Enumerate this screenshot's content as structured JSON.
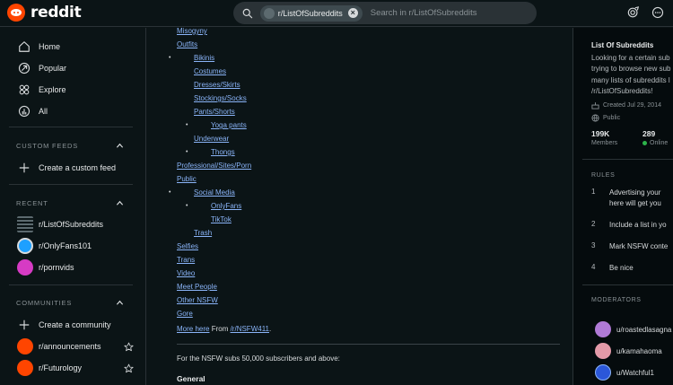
{
  "header": {
    "logo_text": "reddit",
    "search_chip": "r/ListOfSubreddits",
    "search_placeholder": "Search in r/ListOfSubreddits"
  },
  "sidebar": {
    "nav": [
      {
        "label": "Home",
        "icon": "home-icon"
      },
      {
        "label": "Popular",
        "icon": "popular-icon"
      },
      {
        "label": "Explore",
        "icon": "explore-icon"
      },
      {
        "label": "All",
        "icon": "all-icon"
      }
    ],
    "custom_feeds_title": "CUSTOM FEEDS",
    "create_custom_feed": "Create a custom feed",
    "recent_title": "RECENT",
    "recent": [
      "r/ListOfSubreddits",
      "r/OnlyFans101",
      "r/pornvids"
    ],
    "communities_title": "COMMUNITIES",
    "create_community": "Create a community",
    "communities": [
      "r/announcements",
      "r/Futurology"
    ]
  },
  "post": {
    "items": {
      "misogyny": "Misogyny",
      "outfits": "Outfits",
      "bikinis": "Bikinis",
      "costumes": "Costumes",
      "dresses": "Dresses/Skirts",
      "stockings": "Stockings/Socks",
      "pants": "Pants/Shorts",
      "yoga": "Yoga pants",
      "underwear": "Underwear",
      "thongs": "Thongs",
      "professional": "Professional/Sites/Porn",
      "public": "Public",
      "social_media": "Social Media",
      "onlyfans": "OnlyFans",
      "tiktok": "TikTok",
      "trash": "Trash",
      "selfies": "Selfies",
      "trans": "Trans",
      "video": "Video",
      "meet_people": "Meet People",
      "other_nsfw": "Other NSFW",
      "gore": "Gore"
    },
    "more_here": "More here",
    "from_text": " From ",
    "from_link": "/r/NSFW411",
    "period": ".",
    "subs_paragraph": "For the NSFW subs 50,000 subscribers and above:",
    "general_heading": "General"
  },
  "about": {
    "title": "List Of Subreddits",
    "desc_lines": [
      "Looking for a certain sub",
      "trying to browse new sub",
      "many lists of subreddits l",
      "/r/ListOfSubreddits!"
    ],
    "created": "Created Jul 29, 2014",
    "visibility": "Public",
    "members_value": "199K",
    "members_label": "Members",
    "online_value": "289",
    "online_label": "Online"
  },
  "rules": {
    "title": "RULES",
    "items": [
      {
        "num": "1",
        "text": "Advertising your",
        "text2": "here will get you"
      },
      {
        "num": "2",
        "text": "Include a list in yo"
      },
      {
        "num": "3",
        "text": "Mark NSFW conte"
      },
      {
        "num": "4",
        "text": "Be nice"
      }
    ]
  },
  "moderators": {
    "title": "MODERATORS",
    "list": [
      "u/roastedlasagna",
      "u/kamahaoma",
      "u/Watchful1"
    ]
  }
}
